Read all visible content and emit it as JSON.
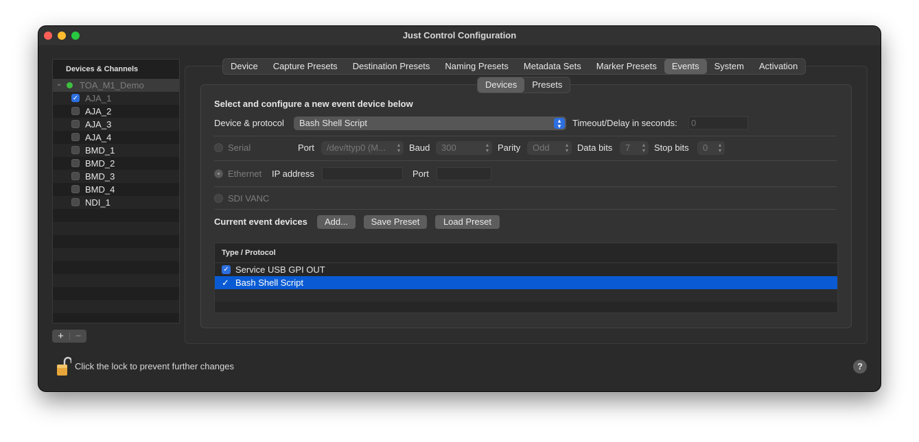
{
  "window": {
    "title": "Just Control Configuration"
  },
  "sidebar": {
    "header": "Devices & Channels",
    "root": {
      "label": "TOA_M1_Demo",
      "status_color": "#3fbf3f",
      "expanded": true
    },
    "items": [
      {
        "label": "AJA_1",
        "checked": true
      },
      {
        "label": "AJA_2",
        "checked": false
      },
      {
        "label": "AJA_3",
        "checked": false
      },
      {
        "label": "AJA_4",
        "checked": false
      },
      {
        "label": "BMD_1",
        "checked": false
      },
      {
        "label": "BMD_2",
        "checked": false
      },
      {
        "label": "BMD_3",
        "checked": false
      },
      {
        "label": "BMD_4",
        "checked": false
      },
      {
        "label": "NDI_1",
        "checked": false
      }
    ],
    "add_label": "+",
    "remove_label": "−"
  },
  "tabs": [
    {
      "label": "Device",
      "selected": false
    },
    {
      "label": "Capture Presets",
      "selected": false
    },
    {
      "label": "Destination Presets",
      "selected": false
    },
    {
      "label": "Naming Presets",
      "selected": false
    },
    {
      "label": "Metadata Sets",
      "selected": false
    },
    {
      "label": "Marker Presets",
      "selected": false
    },
    {
      "label": "Events",
      "selected": true
    },
    {
      "label": "System",
      "selected": false
    },
    {
      "label": "Activation",
      "selected": false
    }
  ],
  "subtabs": [
    {
      "label": "Devices",
      "selected": true
    },
    {
      "label": "Presets",
      "selected": false
    }
  ],
  "events": {
    "heading": "Select and configure a new event device below",
    "device_protocol_label": "Device & protocol",
    "device_protocol_value": "Bash Shell Script",
    "timeout_label": "Timeout/Delay in seconds:",
    "timeout_value": "0",
    "serial": {
      "label": "Serial",
      "port_label": "Port",
      "port_value": "/dev/ttyp0 (M...",
      "baud_label": "Baud",
      "baud_value": "300",
      "parity_label": "Parity",
      "parity_value": "Odd",
      "databits_label": "Data bits",
      "databits_value": "7",
      "stopbits_label": "Stop bits",
      "stopbits_value": "0"
    },
    "ethernet": {
      "label": "Ethernet",
      "ip_label": "IP address",
      "ip_value": "",
      "port_label": "Port",
      "port_value": ""
    },
    "sdi": {
      "label": "SDI VANC"
    },
    "current_label": "Current event devices",
    "add_button": "Add...",
    "save_button": "Save Preset",
    "load_button": "Load Preset",
    "table": {
      "header": "Type / Protocol",
      "rows": [
        {
          "label": "Service USB GPI OUT",
          "checked": true,
          "selected": false
        },
        {
          "label": "Bash Shell Script",
          "checked": true,
          "selected": true
        }
      ]
    }
  },
  "footer": {
    "lock_text": "Click the lock to prevent further changes",
    "help_label": "?"
  },
  "colors": {
    "accent": "#0a5bd3",
    "window_bg": "#2a2a2a",
    "close": "#ff5f57",
    "minimize": "#febc2e",
    "zoom": "#28c840"
  },
  "icons": [
    "chevron-down-icon",
    "lock-open-icon",
    "updown-icon",
    "checkmark-icon",
    "help-icon"
  ]
}
